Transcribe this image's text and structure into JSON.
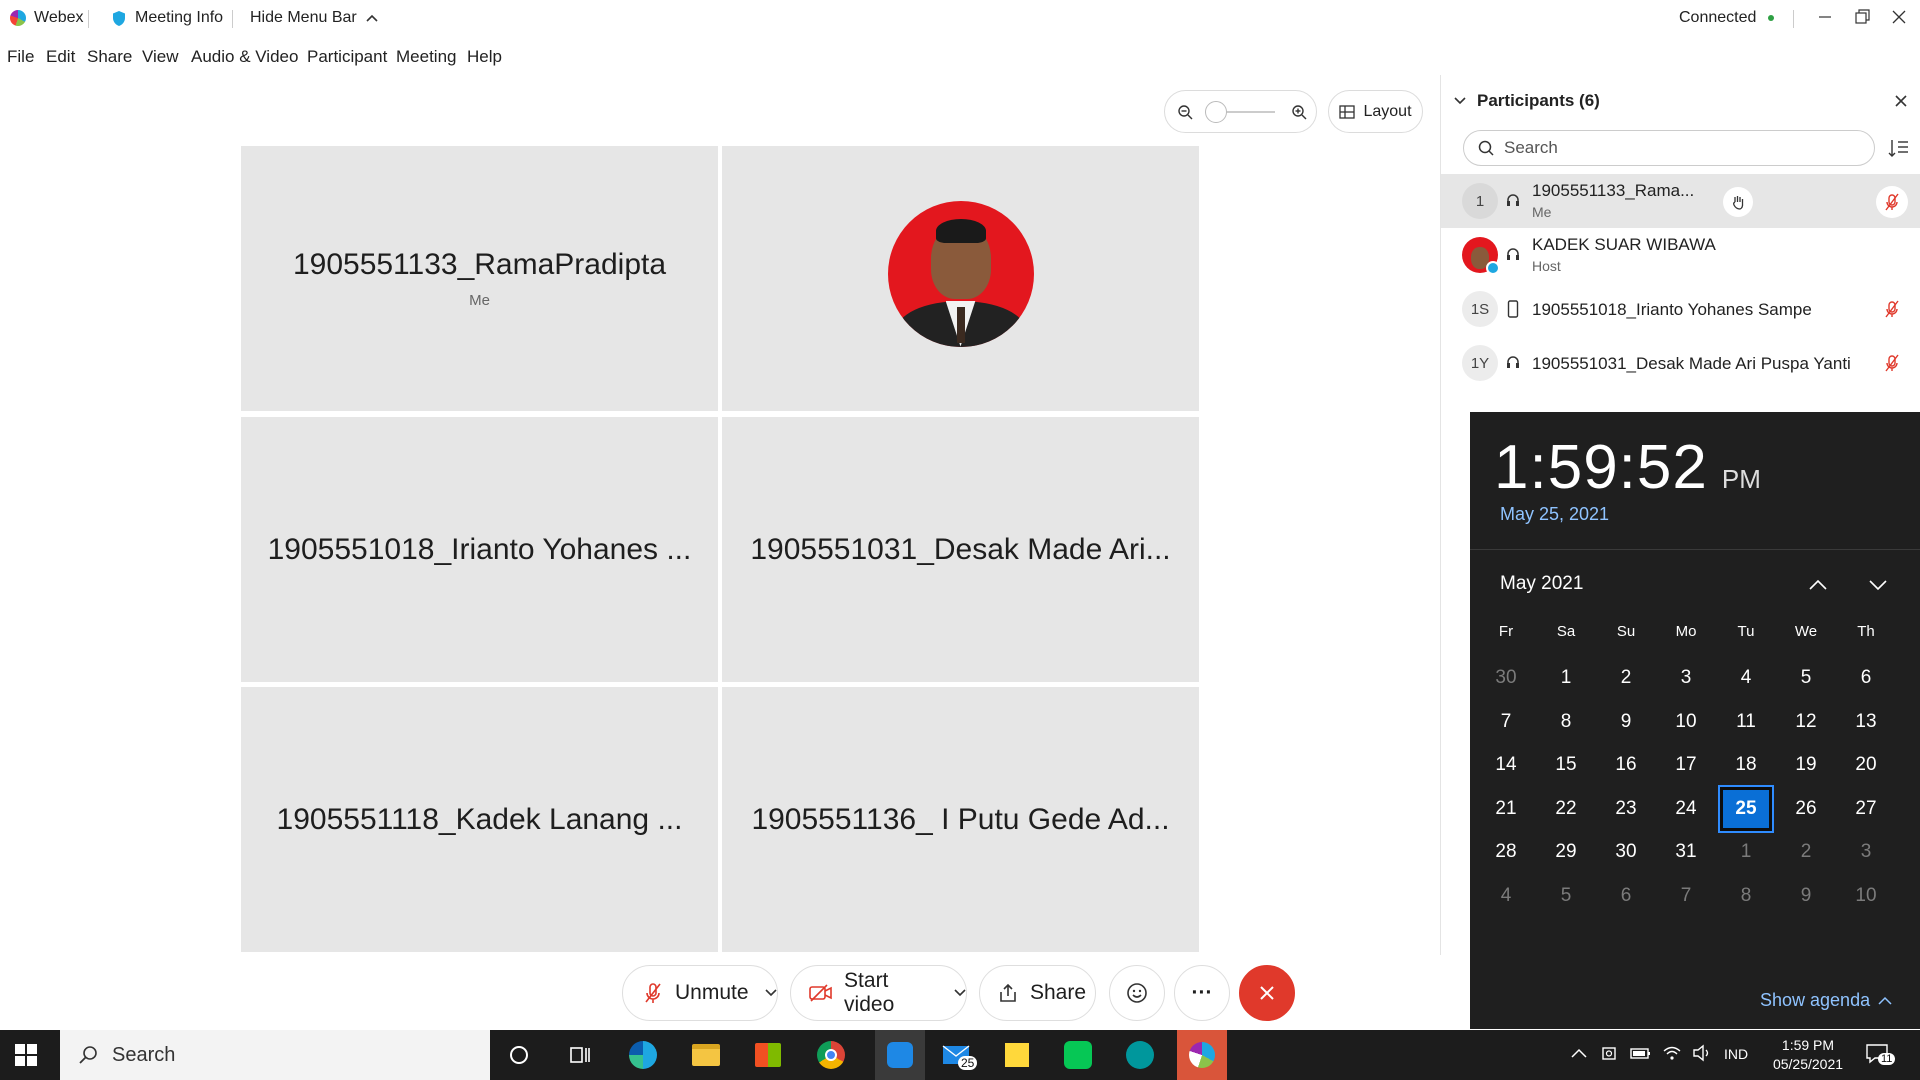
{
  "titlebar": {
    "app_name": "Webex",
    "meeting_info": "Meeting Info",
    "hide_menu": "Hide Menu Bar",
    "status": "Connected",
    "status_color": "#2ea043"
  },
  "menu": [
    "File",
    "Edit",
    "Share",
    "View",
    "Audio & Video",
    "Participant",
    "Meeting",
    "Help"
  ],
  "view_controls": {
    "layout_label": "Layout"
  },
  "tiles": [
    {
      "name": "1905551133_RamaPradipta",
      "sub": "Me"
    },
    {
      "name": "",
      "sub": ""
    },
    {
      "name": "1905551018_Irianto Yohanes ...",
      "sub": ""
    },
    {
      "name": "1905551031_Desak Made Ari...",
      "sub": ""
    },
    {
      "name": "1905551118_Kadek Lanang ...",
      "sub": ""
    },
    {
      "name": "1905551136_ I Putu Gede Ad...",
      "sub": ""
    }
  ],
  "participants_panel": {
    "title": "Participants (6)",
    "search_placeholder": "Search",
    "rows": [
      {
        "initials": "1",
        "name": "1905551133_Rama...",
        "role": "Me"
      },
      {
        "initials": "",
        "name": "KADEK SUAR WIBAWA",
        "role": "Host"
      },
      {
        "initials": "1S",
        "name": "1905551018_Irianto Yohanes Sampe",
        "role": ""
      },
      {
        "initials": "1Y",
        "name": "1905551031_Desak Made Ari Puspa Yanti",
        "role": ""
      }
    ]
  },
  "toolbar": {
    "unmute": "Unmute",
    "start_video": "Start video",
    "share": "Share",
    "more": "···"
  },
  "clock": {
    "time": "1:59:52",
    "ampm": "PM",
    "date": "May 25, 2021",
    "month_label": "May 2021",
    "weekdays": [
      "Fr",
      "Sa",
      "Su",
      "Mo",
      "Tu",
      "We",
      "Th"
    ],
    "weeks": [
      [
        "30",
        "1",
        "2",
        "3",
        "4",
        "5",
        "6"
      ],
      [
        "7",
        "8",
        "9",
        "10",
        "11",
        "12",
        "13"
      ],
      [
        "14",
        "15",
        "16",
        "17",
        "18",
        "19",
        "20"
      ],
      [
        "21",
        "22",
        "23",
        "24",
        "25",
        "26",
        "27"
      ],
      [
        "28",
        "29",
        "30",
        "31",
        "1",
        "2",
        "3"
      ],
      [
        "4",
        "5",
        "6",
        "7",
        "8",
        "9",
        "10"
      ]
    ],
    "today": "25",
    "show_agenda": "Show agenda"
  },
  "taskbar": {
    "search_placeholder": "Search",
    "mail_badge": "25",
    "language": "IND",
    "time": "1:59 PM",
    "date": "05/25/2021",
    "notification_count": "11"
  }
}
